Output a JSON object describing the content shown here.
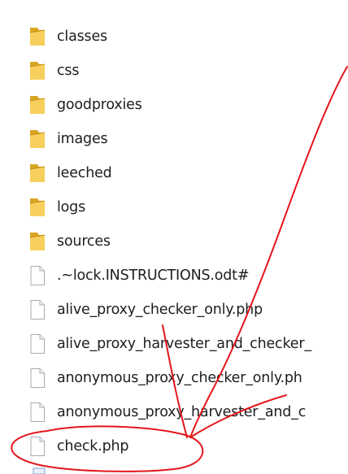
{
  "files": [
    {
      "name": "classes",
      "icon": "folder-icon"
    },
    {
      "name": "css",
      "icon": "folder-icon"
    },
    {
      "name": "goodproxies",
      "icon": "folder-icon"
    },
    {
      "name": "images",
      "icon": "folder-icon"
    },
    {
      "name": "leeched",
      "icon": "folder-icon"
    },
    {
      "name": "logs",
      "icon": "folder-icon"
    },
    {
      "name": "sources",
      "icon": "folder-icon"
    },
    {
      "name": ".~lock.INSTRUCTIONS.odt#",
      "icon": "file-icon"
    },
    {
      "name": "alive_proxy_checker_only.php",
      "icon": "file-icon"
    },
    {
      "name": "alive_proxy_harvester_and_checker_",
      "icon": "file-icon"
    },
    {
      "name": "anonymous_proxy_checker_only.ph",
      "icon": "file-icon"
    },
    {
      "name": "anonymous_proxy_harvester_and_c",
      "icon": "file-icon"
    },
    {
      "name": "check.php",
      "icon": "file-icon"
    }
  ],
  "colors": {
    "folder_back": "#d9a623",
    "folder_front": "#f6cf5c",
    "file_border": "#a7acb3",
    "annotation": "#e4161b",
    "text": "#1e1e1e"
  }
}
